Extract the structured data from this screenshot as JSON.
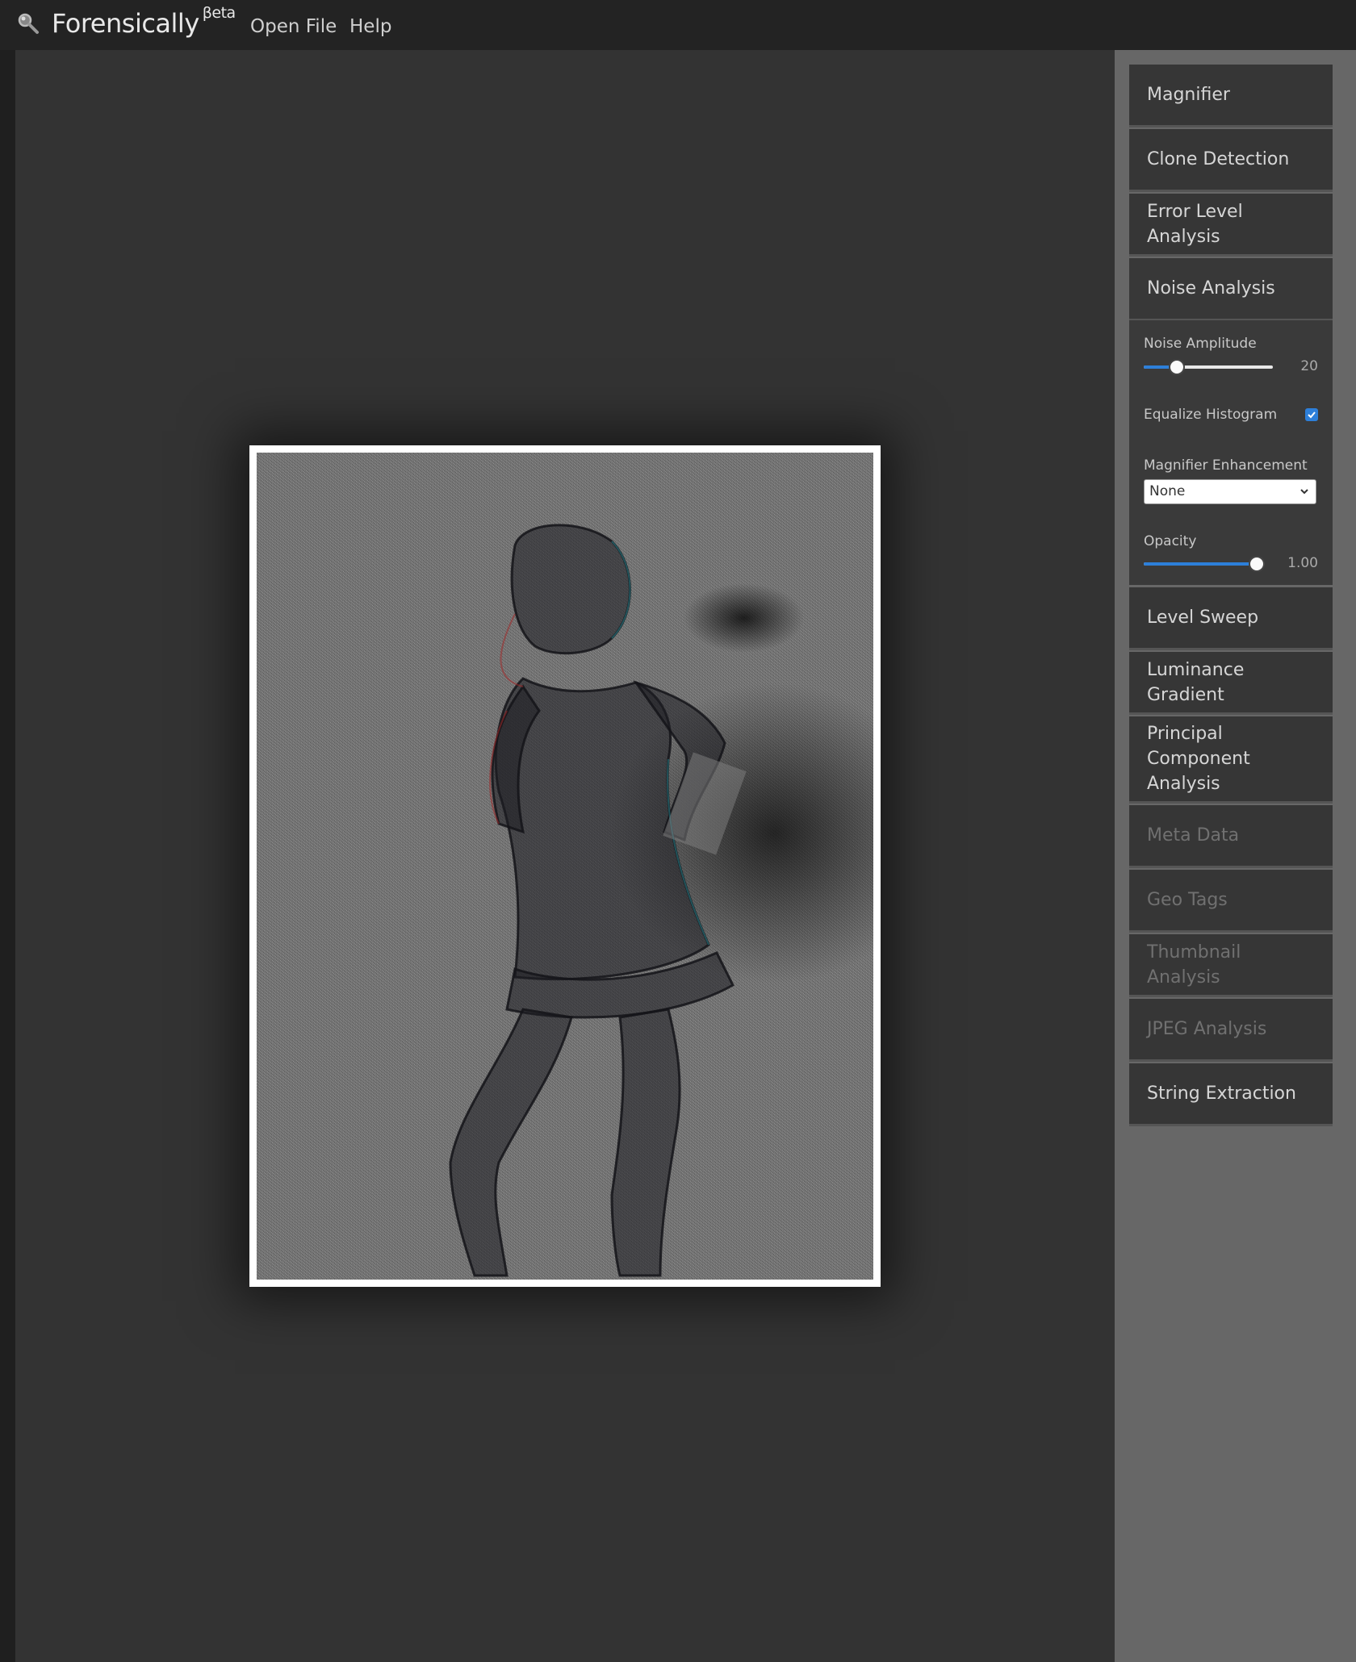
{
  "header": {
    "brand": "Forensically",
    "brand_sup": "βeta",
    "logo_icon": "magnifier-icon",
    "menu": [
      {
        "label": "Open File"
      },
      {
        "label": "Help"
      }
    ]
  },
  "sidebar": {
    "tools": [
      {
        "label": "Magnifier",
        "enabled": true
      },
      {
        "label": "Clone Detection",
        "enabled": true
      },
      {
        "label": "Error Level Analysis",
        "enabled": true
      },
      {
        "label": "Noise Analysis",
        "enabled": true,
        "active": true
      },
      {
        "label": "Level Sweep",
        "enabled": true
      },
      {
        "label": "Luminance Gradient",
        "enabled": true
      },
      {
        "label": "Principal Component Analysis",
        "enabled": true
      },
      {
        "label": "Meta Data",
        "enabled": false
      },
      {
        "label": "Geo Tags",
        "enabled": false
      },
      {
        "label": "Thumbnail Analysis",
        "enabled": false
      },
      {
        "label": "JPEG Analysis",
        "enabled": false
      },
      {
        "label": "String Extraction",
        "enabled": true
      }
    ],
    "noise_panel": {
      "amplitude_label": "Noise Amplitude",
      "amplitude_value": "20",
      "amplitude_fraction": 0.22,
      "equalize_label": "Equalize Histogram",
      "equalize_checked": true,
      "enhancement_label": "Magnifier Enhancement",
      "enhancement_selected": "None",
      "opacity_label": "Opacity",
      "opacity_value": "1.00",
      "opacity_fraction": 1.0
    }
  },
  "colors": {
    "accent": "#2d7fd9",
    "workspace_bg": "#333333",
    "sidebar_bg": "#676767",
    "tool_bg": "#363636"
  }
}
